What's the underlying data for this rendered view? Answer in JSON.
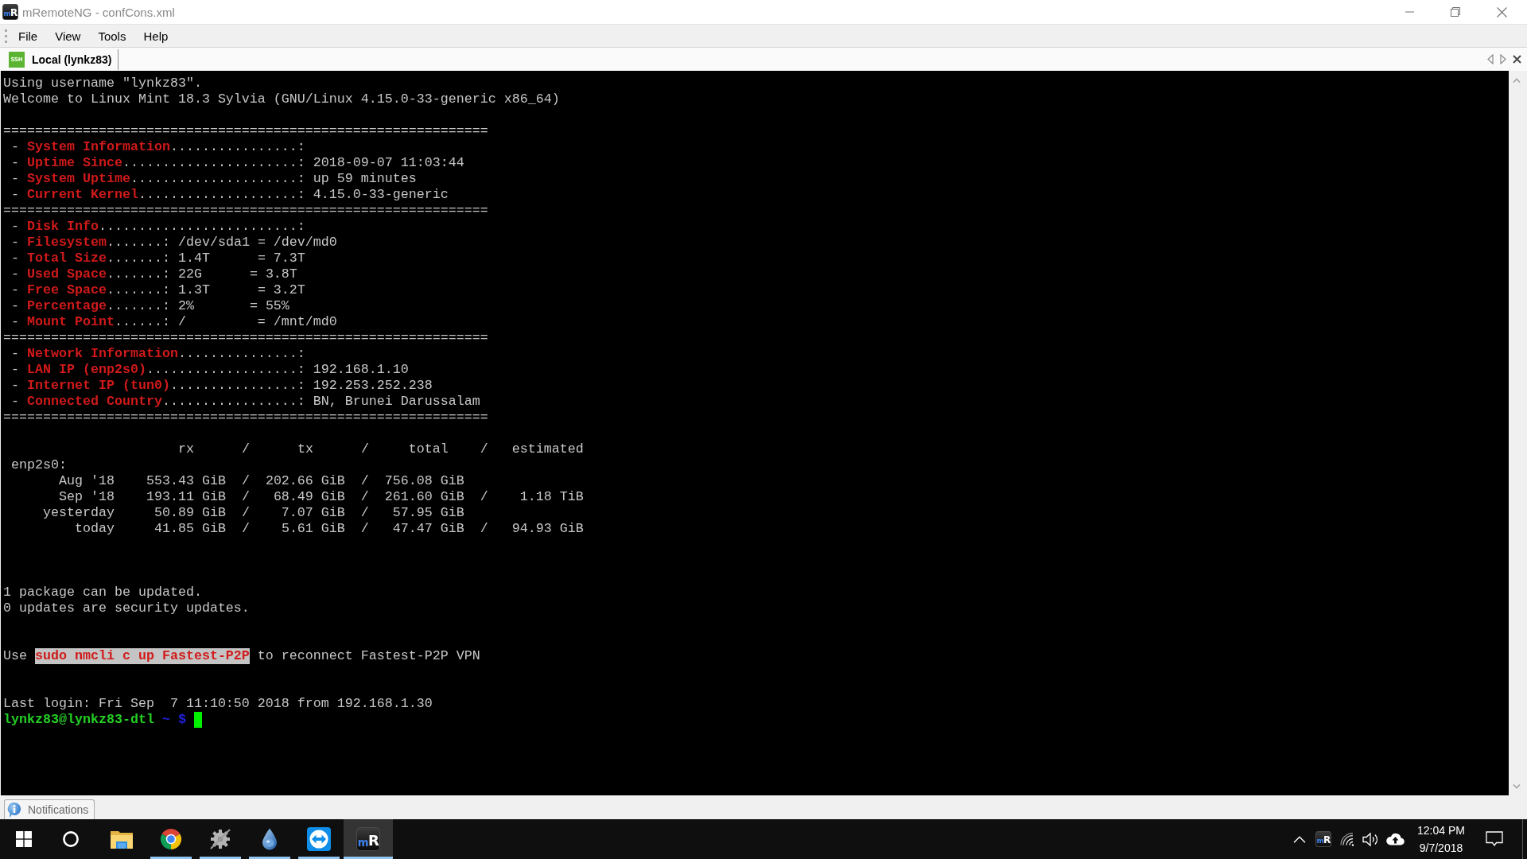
{
  "window": {
    "logo": "mR",
    "title": "mRemoteNG - confCons.xml"
  },
  "menu": [
    "File",
    "View",
    "Tools",
    "Help"
  ],
  "tabs": [
    {
      "badge": "SSH",
      "label": "Local (lynkz83)",
      "selected": true
    }
  ],
  "terminal": {
    "blocks": [
      {
        "lines": [
          {
            "segments": [
              {
                "text": "Using username \"lynkz83\".",
                "kind": "plain"
              }
            ]
          },
          {
            "segments": [
              {
                "text": "Welcome to Linux Mint 18.3 Sylvia (GNU/Linux 4.15.0-33-generic x86_64)",
                "kind": "plain"
              }
            ]
          }
        ]
      },
      {
        "lines": [
          {
            "segments": [
              {
                "text": "=============================================================",
                "kind": "plain"
              }
            ]
          },
          {
            "segments": [
              {
                "text": " - ",
                "kind": "plain"
              },
              {
                "text": "System Information",
                "kind": "label"
              },
              {
                "text": "................:",
                "kind": "plain"
              }
            ]
          },
          {
            "segments": [
              {
                "text": " - ",
                "kind": "plain"
              },
              {
                "text": "Uptime Since",
                "kind": "label"
              },
              {
                "text": "......................: 2018-09-07 11:03:44",
                "kind": "plain"
              }
            ]
          },
          {
            "segments": [
              {
                "text": " - ",
                "kind": "plain"
              },
              {
                "text": "System Uptime",
                "kind": "label"
              },
              {
                "text": ".....................: up 59 minutes",
                "kind": "plain"
              }
            ]
          },
          {
            "segments": [
              {
                "text": " - ",
                "kind": "plain"
              },
              {
                "text": "Current Kernel",
                "kind": "label"
              },
              {
                "text": "....................: 4.15.0-33-generic",
                "kind": "plain"
              }
            ]
          },
          {
            "segments": [
              {
                "text": "=============================================================",
                "kind": "plain"
              }
            ]
          },
          {
            "segments": [
              {
                "text": " - ",
                "kind": "plain"
              },
              {
                "text": "Disk Info",
                "kind": "label"
              },
              {
                "text": ".........................:",
                "kind": "plain"
              }
            ]
          },
          {
            "segments": [
              {
                "text": " - ",
                "kind": "plain"
              },
              {
                "text": "Filesystem",
                "kind": "label"
              },
              {
                "text": ".......: /dev/sda1 = /dev/md0",
                "kind": "plain"
              }
            ]
          },
          {
            "segments": [
              {
                "text": " - ",
                "kind": "plain"
              },
              {
                "text": "Total Size",
                "kind": "label"
              },
              {
                "text": ".......: 1.4T      = 7.3T",
                "kind": "plain"
              }
            ]
          },
          {
            "segments": [
              {
                "text": " - ",
                "kind": "plain"
              },
              {
                "text": "Used Space",
                "kind": "label"
              },
              {
                "text": ".......: 22G      = 3.8T",
                "kind": "plain"
              }
            ]
          },
          {
            "segments": [
              {
                "text": " - ",
                "kind": "plain"
              },
              {
                "text": "Free Space",
                "kind": "label"
              },
              {
                "text": ".......: 1.3T      = 3.2T",
                "kind": "plain"
              }
            ]
          },
          {
            "segments": [
              {
                "text": " - ",
                "kind": "plain"
              },
              {
                "text": "Percentage",
                "kind": "label"
              },
              {
                "text": ".......: 2%       = 55%",
                "kind": "plain"
              }
            ]
          },
          {
            "segments": [
              {
                "text": " - ",
                "kind": "plain"
              },
              {
                "text": "Mount Point",
                "kind": "label"
              },
              {
                "text": "......: /         = /mnt/md0",
                "kind": "plain"
              }
            ]
          },
          {
            "segments": [
              {
                "text": "=============================================================",
                "kind": "plain"
              }
            ]
          },
          {
            "segments": [
              {
                "text": " - ",
                "kind": "plain"
              },
              {
                "text": "Network Information",
                "kind": "label"
              },
              {
                "text": "...............:",
                "kind": "plain"
              }
            ]
          },
          {
            "segments": [
              {
                "text": " - ",
                "kind": "plain"
              },
              {
                "text": "LAN IP (enp2s0)",
                "kind": "label"
              },
              {
                "text": "...................: 192.168.1.10",
                "kind": "plain"
              }
            ]
          },
          {
            "segments": [
              {
                "text": " - ",
                "kind": "plain"
              },
              {
                "text": "Internet IP (tun0)",
                "kind": "label"
              },
              {
                "text": "................: 192.253.252.238",
                "kind": "plain"
              }
            ]
          },
          {
            "segments": [
              {
                "text": " - ",
                "kind": "plain"
              },
              {
                "text": "Connected Country",
                "kind": "label"
              },
              {
                "text": ".................: BN, Brunei Darussalam",
                "kind": "plain"
              }
            ]
          },
          {
            "segments": [
              {
                "text": "=============================================================",
                "kind": "plain"
              }
            ]
          }
        ]
      },
      {
        "lines": [
          {
            "segments": [
              {
                "text": "                      rx      /      tx      /     total    /   estimated",
                "kind": "plain"
              }
            ]
          },
          {
            "segments": [
              {
                "text": " enp2s0:",
                "kind": "plain"
              }
            ]
          },
          {
            "segments": [
              {
                "text": "       Aug '18    553.43 GiB  /  202.66 GiB  /  756.08 GiB",
                "kind": "plain"
              }
            ]
          },
          {
            "segments": [
              {
                "text": "       Sep '18    193.11 GiB  /   68.49 GiB  /  261.60 GiB  /    1.18 TiB",
                "kind": "plain"
              }
            ]
          },
          {
            "segments": [
              {
                "text": "     yesterday     50.89 GiB  /    7.07 GiB  /   57.95 GiB",
                "kind": "plain"
              }
            ]
          },
          {
            "segments": [
              {
                "text": "         today     41.85 GiB  /    5.61 GiB  /   47.47 GiB  /   94.93 GiB",
                "kind": "plain"
              }
            ]
          }
        ]
      },
      {
        "lines": [
          {
            "segments": [
              {
                "text": "1 package can be updated.",
                "kind": "plain"
              }
            ]
          },
          {
            "segments": [
              {
                "text": "0 updates are security updates.",
                "kind": "plain"
              }
            ]
          }
        ]
      },
      {
        "lines": [
          {
            "segments": [
              {
                "text": "Use ",
                "kind": "plain"
              },
              {
                "text": "sudo nmcli c up Fastest-P2P",
                "kind": "highlight"
              },
              {
                "text": " to reconnect Fastest-P2P VPN",
                "kind": "plain"
              }
            ]
          }
        ]
      },
      {
        "lines": [
          {
            "segments": [
              {
                "text": "Last login: Fri Sep  7 11:10:50 2018 from 192.168.1.30",
                "kind": "plain"
              }
            ]
          },
          {
            "segments": [
              {
                "text": "lynkz83@lynkz83-dtl",
                "kind": "user"
              },
              {
                "text": " ~ $",
                "kind": "path"
              }
            ],
            "cursor": true
          }
        ]
      }
    ]
  },
  "notifications": {
    "label": "Notifications"
  },
  "taskbar": {
    "apps": [
      {
        "kind": "folder",
        "running": false,
        "selected": false
      },
      {
        "kind": "wheel",
        "running": true,
        "selected": false
      },
      {
        "kind": "gear",
        "running": true,
        "selected": false
      },
      {
        "kind": "droplet",
        "running": true,
        "selected": false
      },
      {
        "kind": "arrows",
        "running": true,
        "selected": false
      },
      {
        "kind": "logo",
        "logo": "mR",
        "running": true,
        "selected": true
      }
    ],
    "tray": {
      "logo": "mR",
      "time": "12:04 PM",
      "date": "9/7/2018"
    }
  }
}
